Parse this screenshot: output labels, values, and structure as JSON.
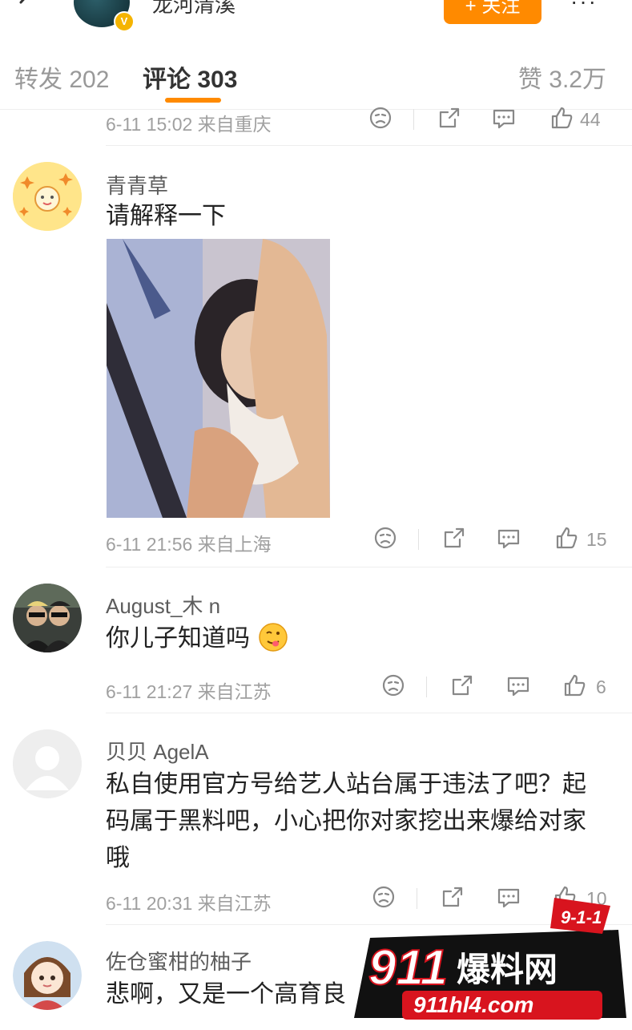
{
  "header": {
    "poster_name": "龙河清溪",
    "verified_mark": "V",
    "follow_label": "+ 关注",
    "more_label": "···"
  },
  "tabs": {
    "repost": "转发 202",
    "comments": "评论 303",
    "likes": "赞 3.2万"
  },
  "comments": [
    {
      "meta": "6-11 15:02 来自重庆",
      "likes": "44"
    },
    {
      "username": "青青草",
      "text": "请解释一下",
      "meta": "6-11 21:56 来自上海",
      "likes": "15"
    },
    {
      "username": "August_木 n",
      "text": "你儿子知道吗",
      "meta": "6-11 21:27 来自江苏",
      "likes": "6"
    },
    {
      "username": "贝贝 AgelA",
      "text": "私自使用官方号给艺人站台属于违法了吧？起码属于黑料吧，小心把你对家挖出来爆给对家哦",
      "meta": "6-11 20:31 来自江苏",
      "likes": "10"
    },
    {
      "username": "佐仓蜜柑的柚子",
      "text": "悲啊，又是一个高育良"
    }
  ],
  "watermark": {
    "badge": "9-1-1",
    "brand_num": "911",
    "brand_cn": "爆料网",
    "url": "911hl4.com"
  },
  "colors": {
    "accent": "#ff8a00",
    "meta_gray": "#a0a0a0",
    "watermark_red": "#d8141e"
  },
  "icons": [
    "back-icon",
    "dislike-icon",
    "share-icon",
    "comment-icon",
    "like-icon",
    "emoji-tongue-icon"
  ]
}
